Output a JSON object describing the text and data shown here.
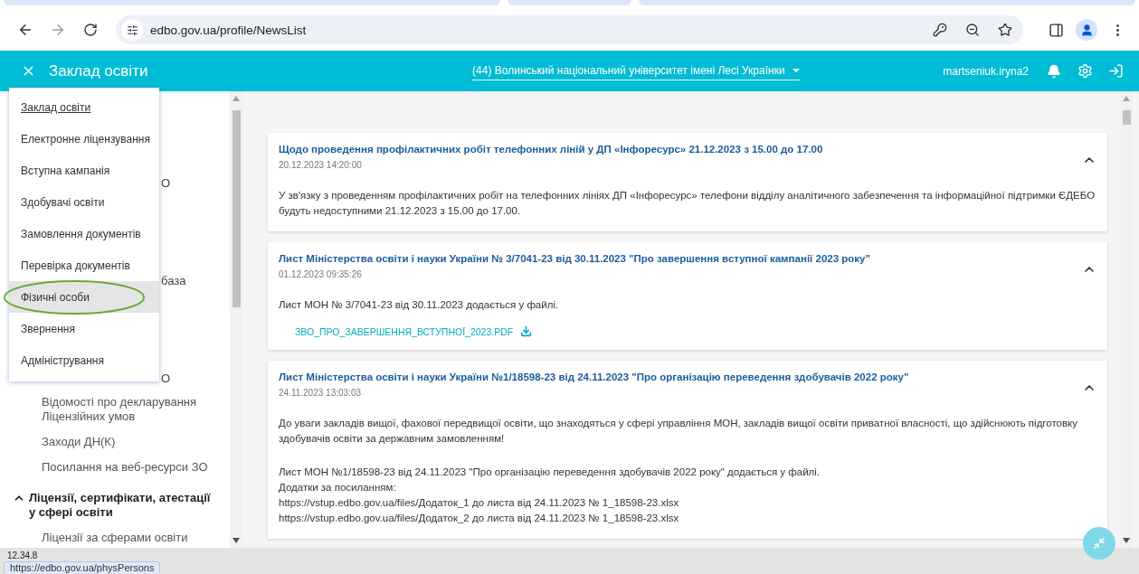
{
  "browser": {
    "url": "edbo.gov.ua/profile/NewsList"
  },
  "header": {
    "title": "Заклад освіти",
    "institution": "(44) Волинський національний університет імені Лесі Українки",
    "user": "martseniuk.iryna2"
  },
  "nav_menu": {
    "items": [
      {
        "label": "Заклад освіти",
        "current": true,
        "highlighted": false,
        "circled": false
      },
      {
        "label": "Електронне ліцензування",
        "current": false,
        "highlighted": false,
        "circled": false
      },
      {
        "label": "Вступна кампанія",
        "current": false,
        "highlighted": false,
        "circled": false
      },
      {
        "label": "Здобувачі освіти",
        "current": false,
        "highlighted": false,
        "circled": false
      },
      {
        "label": "Замовлення документів",
        "current": false,
        "highlighted": false,
        "circled": false
      },
      {
        "label": "Перевірка документів",
        "current": false,
        "highlighted": false,
        "circled": false
      },
      {
        "label": "Фізичні особи",
        "current": false,
        "highlighted": true,
        "circled": true
      },
      {
        "label": "Звернення",
        "current": false,
        "highlighted": false,
        "circled": false
      },
      {
        "label": "Адміністрування",
        "current": false,
        "highlighted": false,
        "circled": false
      }
    ]
  },
  "sidebar": {
    "items": [
      {
        "kind": "fragment",
        "label": "О"
      },
      {
        "kind": "fragment",
        "label": "база"
      },
      {
        "kind": "fragment",
        "label": "О"
      },
      {
        "kind": "link",
        "label": "Відомості про декларування Ліцензійних умов"
      },
      {
        "kind": "link",
        "label": "Заходи ДН(К)"
      },
      {
        "kind": "link",
        "label": "Посилання на веб-ресурси ЗО"
      },
      {
        "kind": "section",
        "label": "Ліцензії, сертифікати, атестації у сфері освіти",
        "expanded": true
      },
      {
        "kind": "link",
        "label": "Ліцензії за сферами освіти"
      }
    ]
  },
  "news": [
    {
      "title": "Щодо проведення профілактичних робіт телефонних ліній у ДП «Інфоресурс» 21.12.2023 з 15.00 до 17.00",
      "date": "20.12.2023 14:20:00",
      "expanded": true,
      "body": [
        [
          "У зв'язку з проведенням профілактичних робіт на телефонних лініях ДП «Інфоресурс» телефони відділу аналітичного забезпечення та інформаційної підтримки ЄДЕБО будуть недоступними 21.12.2023 з 15.00 до 17.00."
        ]
      ]
    },
    {
      "title": "Лист Міністерства освіти і науки України № 3/7041-23 від 30.11.2023 \"Про завершення вступної кампанії 2023 року\"",
      "date": "01.12.2023 09:35:26",
      "expanded": true,
      "body": [
        [
          "Лист МОН № 3/7041-23 від 30.11.2023 додається у файлі."
        ]
      ],
      "attachment": "ЗВО_ПРО_ЗАВЕРШЕННЯ_ВСТУПНОЇ_2023.PDF"
    },
    {
      "title": "Лист Міністерства освіти і науки України №1/18598-23 від 24.11.2023 \"Про організацію переведення здобувачів 2022 року\"",
      "date": "24.11.2023 13:03:03",
      "expanded": true,
      "body": [
        [
          "До уваги закладів вищої, фахової передвищої освіти, що знаходяться у сфері управління МОН, закладів вищої освіти приватної власності, що здійснюють підготовку здобувачів освіти за державним замовленням!"
        ],
        [
          "Лист МОН №1/18598-23 від 24.11.2023 \"Про організацію переведення здобувачів 2022 року\" додається у файлі.",
          "Додатки за посиланням:",
          "https://vstup.edbo.gov.ua/files/Додаток_1 до листа від 24.11.2023 № 1_18598-23.xlsx",
          "https://vstup.edbo.gov.ua/files/Додаток_2 до листа від 24.11.2023 № 1_18598-23.xlsx"
        ]
      ]
    }
  ],
  "status": {
    "version": "12.34.8",
    "link_preview": "https://edbo.gov.ua/physPersons"
  }
}
